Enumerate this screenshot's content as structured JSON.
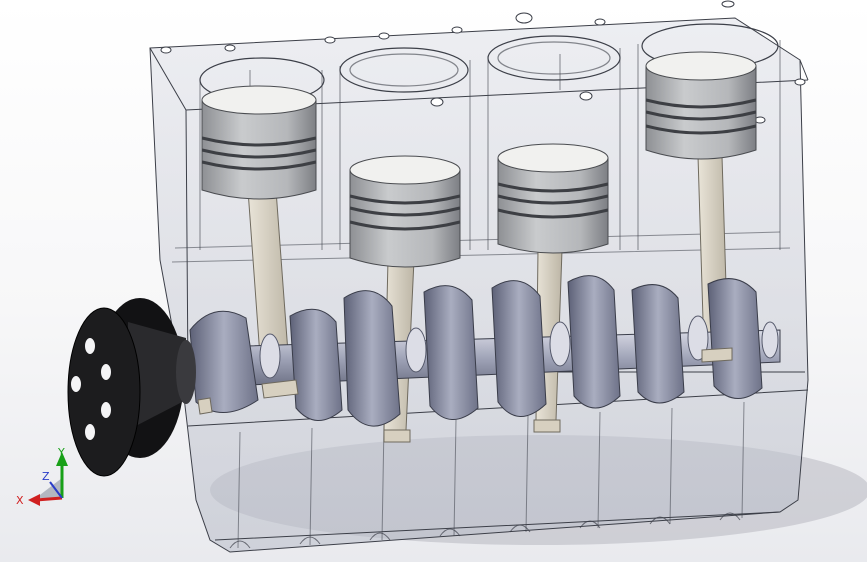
{
  "viewport": {
    "model": "inline-four-cylinder-engine-block",
    "display_style": "transparent-with-edges",
    "cylinders": 4,
    "colors": {
      "background_top": "#ffffff",
      "background_bottom": "#e6e7eb",
      "block_edges": "#3c3f48",
      "block_fill": "#c9ccd6",
      "piston": "#b9bbbe",
      "piston_top": "#f1f1ef",
      "ring": "#3d3f44",
      "connecting_rod": "#d8d2c4",
      "crank_web": "#8f93a8",
      "pulley": "#1c1c1e",
      "axis_x": "#d02020",
      "axis_y": "#18a018",
      "axis_z": "#2a3cc8"
    }
  },
  "triad": {
    "x_label": "X",
    "y_label": "Y",
    "z_label": "Z"
  }
}
